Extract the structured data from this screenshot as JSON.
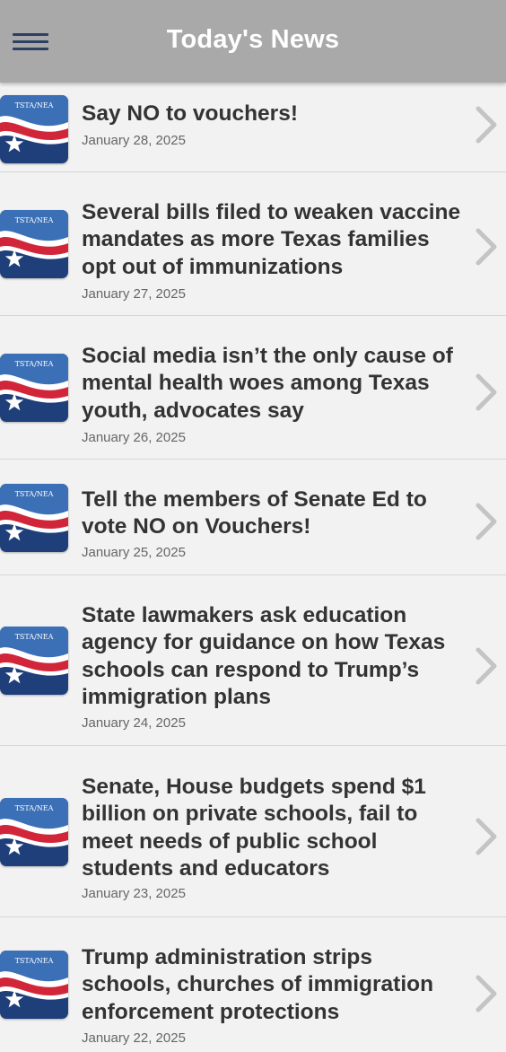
{
  "header": {
    "title": "Today's News",
    "menu_icon": "hamburger-menu-icon"
  },
  "logo": {
    "text": "TSTA/NEA",
    "colors": {
      "blue_top": "#3b6fb6",
      "red": "#d1263a",
      "navy": "#1f3f7a",
      "white": "#ffffff"
    }
  },
  "news": {
    "items": [
      {
        "title": "Say NO to vouchers!",
        "date": "January 28, 2025"
      },
      {
        "title": "Several bills filed to weaken vaccine mandates as more Texas families opt out of immunizations",
        "date": "January 27, 2025"
      },
      {
        "title": "Social media isn’t the only cause of mental health woes among Texas youth, advocates say",
        "date": "January 26, 2025"
      },
      {
        "title": "Tell the members of Senate Ed to vote NO on Vouchers!",
        "date": "January 25, 2025"
      },
      {
        "title": "State lawmakers ask education agency for guidance on how Texas schools can respond to Trump’s immigration plans",
        "date": "January 24, 2025"
      },
      {
        "title": "Senate, House budgets spend $1 billion on private schools, fail to meet needs of public school students and educators",
        "date": "January 23, 2025"
      },
      {
        "title": "Trump administration strips schools, churches of immigration enforcement protections",
        "date": "January 22, 2025"
      }
    ]
  }
}
